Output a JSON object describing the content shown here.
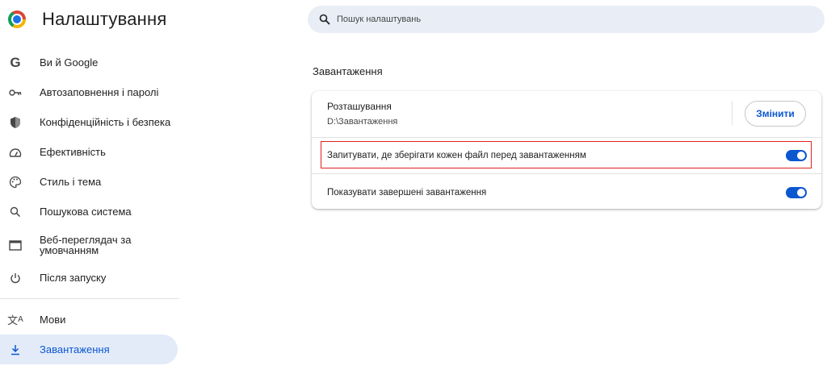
{
  "header": {
    "title": "Налаштування",
    "search_placeholder": "Пошук налаштувань"
  },
  "sidebar": {
    "items": [
      {
        "label": "Ви й Google",
        "icon": "google-icon"
      },
      {
        "label": "Автозаповнення і паролі",
        "icon": "key-icon"
      },
      {
        "label": "Конфіденційність і безпека",
        "icon": "shield-icon"
      },
      {
        "label": "Ефективність",
        "icon": "speedometer-icon"
      },
      {
        "label": "Стиль і тема",
        "icon": "palette-icon"
      },
      {
        "label": "Пошукова система",
        "icon": "search-icon"
      },
      {
        "label": "Веб-переглядач за умовчанням",
        "icon": "browser-window-icon"
      },
      {
        "label": "Після запуску",
        "icon": "power-icon"
      },
      {
        "label": "Мови",
        "icon": "translate-icon"
      },
      {
        "label": "Завантаження",
        "icon": "download-icon",
        "active": true
      }
    ]
  },
  "main": {
    "section_title": "Завантаження",
    "location": {
      "title": "Розташування",
      "path": "D:\\Завантаження",
      "change_label": "Змінити"
    },
    "ask_where": {
      "label": "Запитувати, де зберігати кожен файл перед завантаженням",
      "enabled": true
    },
    "show_completed": {
      "label": "Показувати завершені завантаження",
      "enabled": true
    }
  },
  "colors": {
    "accent": "#0b57d0",
    "active_nav_bg": "#e3ebf9",
    "search_bg": "#e9eef6",
    "highlight_border": "#e02020"
  }
}
